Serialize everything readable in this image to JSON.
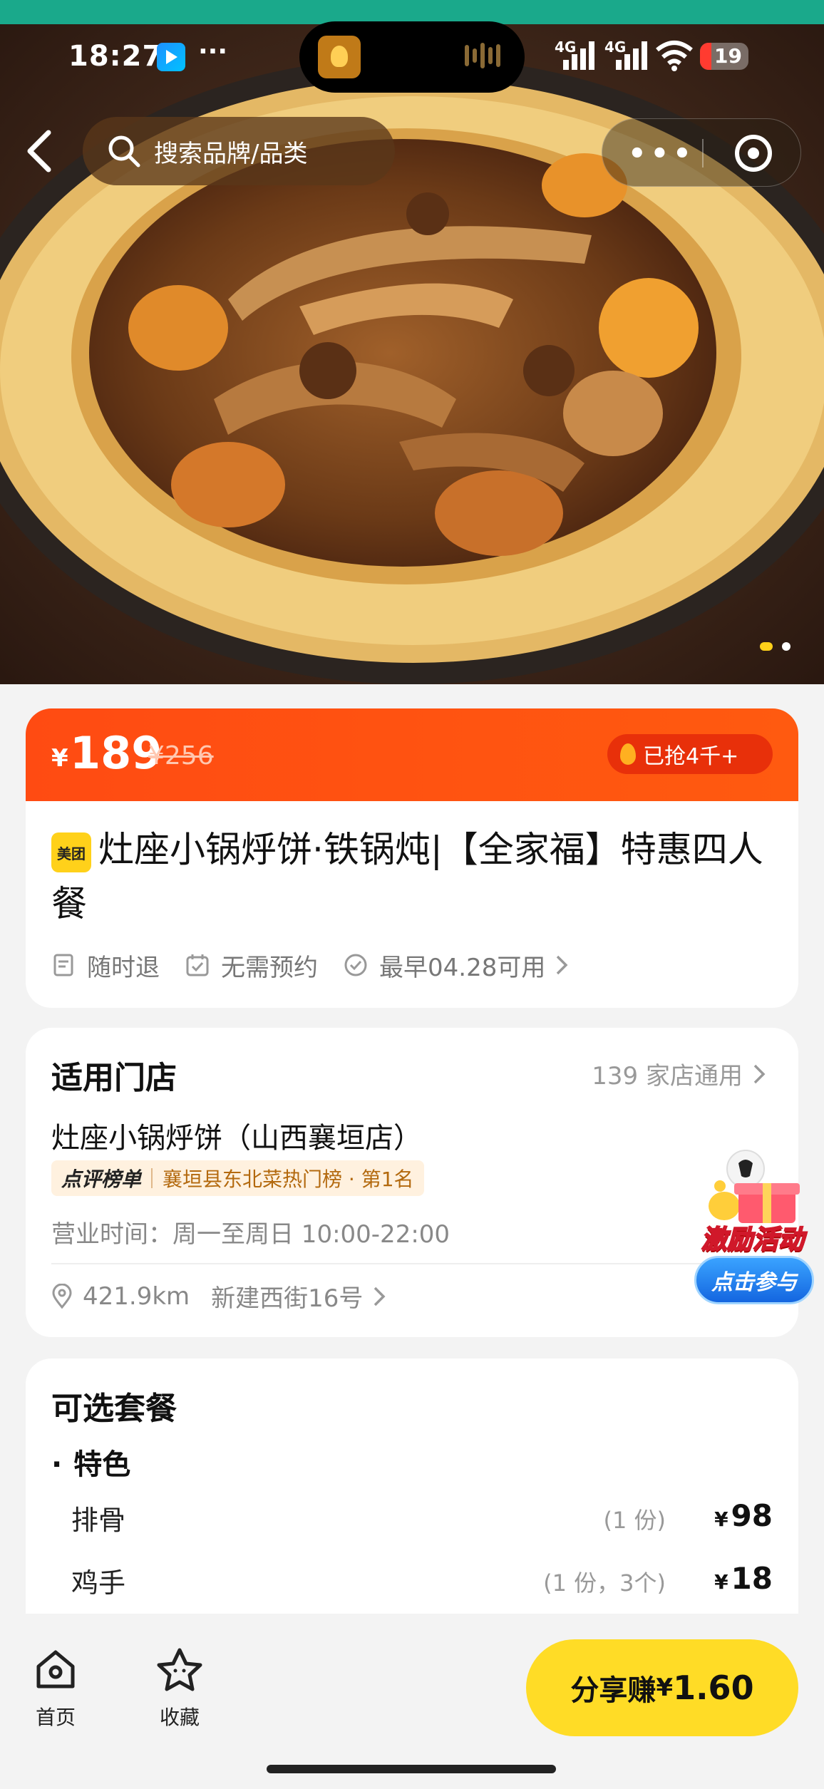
{
  "status_bar": {
    "time": "18:27",
    "more": "···",
    "net1": "4G",
    "net2": "4G",
    "battery": "19",
    "battery_color": "#ff3b30"
  },
  "nav": {
    "search_placeholder": "搜索品牌/品类",
    "capsule_more": "•••"
  },
  "price": {
    "currency": "¥",
    "current": "189",
    "original": "¥256",
    "sold": "已抢4千+",
    "accent": "#ff4b12"
  },
  "deal": {
    "platform_badge": "美团",
    "title": "灶座小锅烀饼·铁锅炖|【全家福】特惠四人餐",
    "tags": [
      "随时退",
      "无需预约",
      "最早04.28可用"
    ]
  },
  "store": {
    "section_title": "适用门店",
    "count": "139 家店通用",
    "name": "灶座小锅烀饼（山西襄垣店）",
    "rank_label": "点评榜单",
    "rank_text": "襄垣县东北菜热门榜 · 第1名",
    "hours": "营业时间：周一至周日 10:00-22:00",
    "distance": "421.9km",
    "address": "新建西街16号"
  },
  "promo": {
    "title": "激励活动",
    "button": "点击参与"
  },
  "packages": {
    "section_title": "可选套餐",
    "group": "特色",
    "items": [
      {
        "name": "排骨",
        "qty": "(1 份)",
        "currency": "¥",
        "price": "98"
      },
      {
        "name": "鸡手",
        "qty": "(1 份，3个)",
        "currency": "¥",
        "price": "18"
      }
    ]
  },
  "bottom": {
    "tab_home": "首页",
    "tab_fav": "收藏",
    "share_label": "分享赚",
    "share_currency": "¥",
    "share_amount": "1.60",
    "share_color": "#ffdc26"
  }
}
